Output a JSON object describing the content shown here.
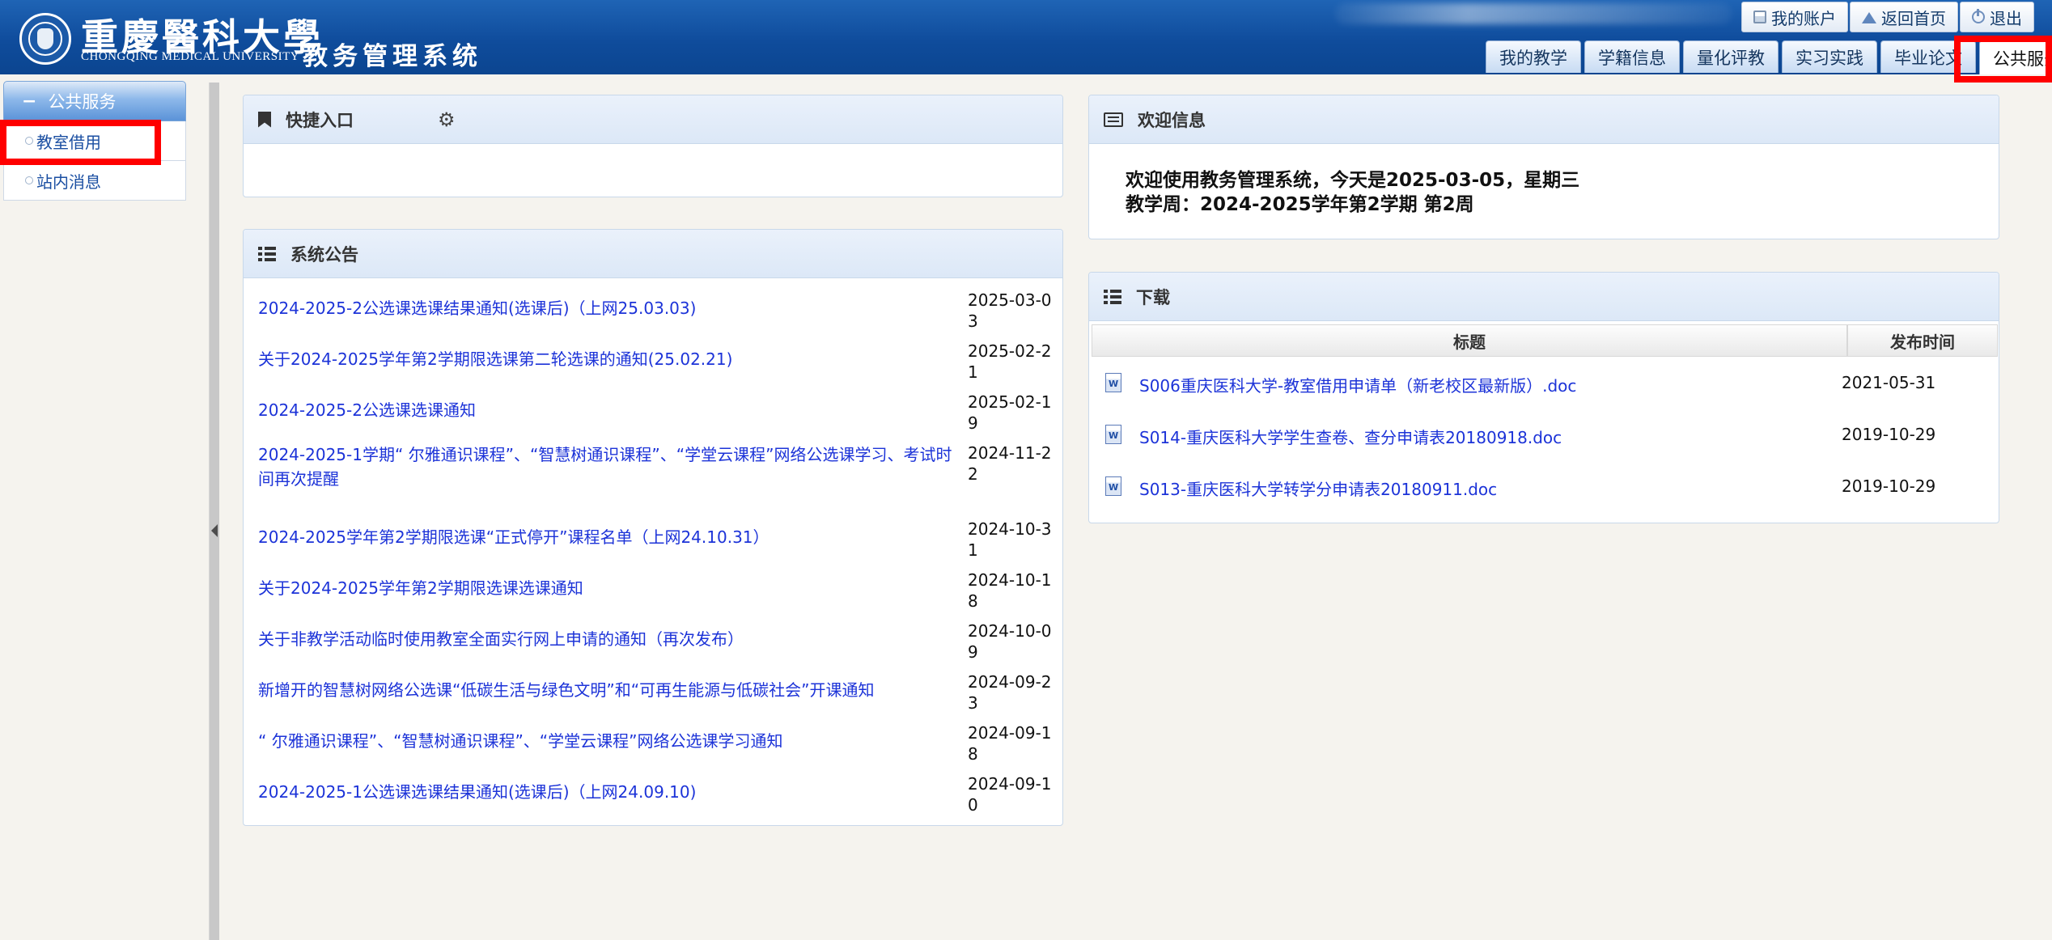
{
  "header": {
    "logo_cn": "重慶醫科大學",
    "logo_en": "CHONGQING MEDICAL UNIVERSITY",
    "system_title": "教务管理系统",
    "top_links": [
      {
        "label": "我的账户",
        "icon": "account-icon"
      },
      {
        "label": "返回首页",
        "icon": "home-icon"
      },
      {
        "label": "退出",
        "icon": "logout-icon"
      }
    ],
    "nav_tabs": [
      {
        "label": "我的教学"
      },
      {
        "label": "学籍信息"
      },
      {
        "label": "量化评教"
      },
      {
        "label": "实习实践"
      },
      {
        "label": "毕业论文"
      },
      {
        "label": "公共服务",
        "active": true
      }
    ]
  },
  "sidebar": {
    "section_title": "公共服务",
    "items": [
      {
        "label": "教室借用"
      },
      {
        "label": "站内消息"
      }
    ]
  },
  "quick_entry": {
    "title": "快捷入口",
    "icon": "bookmark-icon",
    "settings_icon": "gear-icon"
  },
  "announcements": {
    "title": "系统公告",
    "icon": "list-icon",
    "items": [
      {
        "title": "2024-2025-2公选课选课结果通知(选课后)（上网25.03.03)",
        "date": "2025-03-03"
      },
      {
        "title": "关于2024-2025学年第2学期限选课第二轮选课的通知(25.02.21)",
        "date": "2025-02-21"
      },
      {
        "title": "2024-2025-2公选课选课通知",
        "date": "2025-02-19"
      },
      {
        "title": "2024-2025-1学期“ 尔雅通识课程”、“智慧树通识课程”、“学堂云课程”网络公选课学习、考试时间再次提醒",
        "date": "2024-11-22"
      },
      {
        "title": "2024-2025学年第2学期限选课“正式停开”课程名单（上网24.10.31）",
        "date": "2024-10-31"
      },
      {
        "title": "关于2024-2025学年第2学期限选课选课通知",
        "date": "2024-10-18"
      },
      {
        "title": "关于非教学活动临时使用教室全面实行网上申请的通知（再次发布）",
        "date": "2024-10-09"
      },
      {
        "title": "新增开的智慧树网络公选课“低碳生活与绿色文明”和“可再生能源与低碳社会”开课通知",
        "date": "2024-09-23"
      },
      {
        "title": "“ 尔雅通识课程”、“智慧树通识课程”、“学堂云课程”网络公选课学习通知",
        "date": "2024-09-18"
      },
      {
        "title": "2024-2025-1公选课选课结果通知(选课后)（上网24.09.10)",
        "date": "2024-09-10"
      }
    ]
  },
  "welcome": {
    "title": "欢迎信息",
    "icon": "message-icon",
    "line1": "欢迎使用教务管理系统，今天是2025-03-05，星期三",
    "line2": "教学周：2024-2025学年第2学期 第2周"
  },
  "downloads": {
    "title": "下载",
    "icon": "list-icon",
    "columns": [
      "标题",
      "发布时间"
    ],
    "items": [
      {
        "title": "S006重庆医科大学-教室借用申请单（新老校区最新版）.doc",
        "date": "2021-05-31",
        "icon": "word-doc-icon"
      },
      {
        "title": "S014-重庆医科大学学生查卷、查分申请表20180918.doc",
        "date": "2019-10-29",
        "icon": "word-doc-icon"
      },
      {
        "title": "S013-重庆医科大学转学分申请表20180911.doc",
        "date": "2019-10-29",
        "icon": "word-doc-icon"
      }
    ]
  },
  "colors": {
    "header_blue": "#0f4c9c",
    "link_blue": "#1c33d8",
    "highlight_red": "#ff0000"
  }
}
